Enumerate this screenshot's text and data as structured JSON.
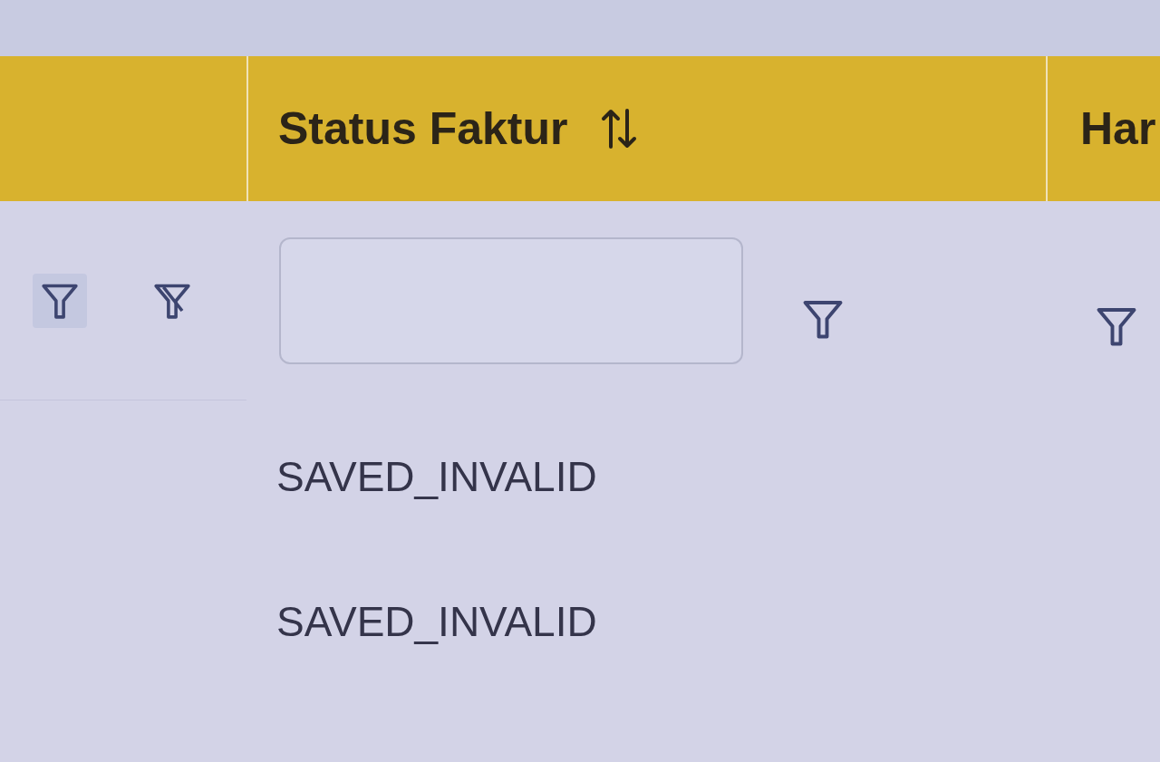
{
  "table": {
    "columns": [
      {
        "kind": "blank"
      },
      {
        "kind": "sortable",
        "label": "Status Faktur"
      },
      {
        "kind": "plain",
        "label": "Har"
      }
    ],
    "filters": [
      {
        "kind": "actions"
      },
      {
        "kind": "text"
      },
      {
        "kind": "menu"
      }
    ],
    "rows": [
      {
        "status_faktur": "SAVED_INVALID"
      },
      {
        "status_faktur": "SAVED_INVALID"
      }
    ]
  }
}
